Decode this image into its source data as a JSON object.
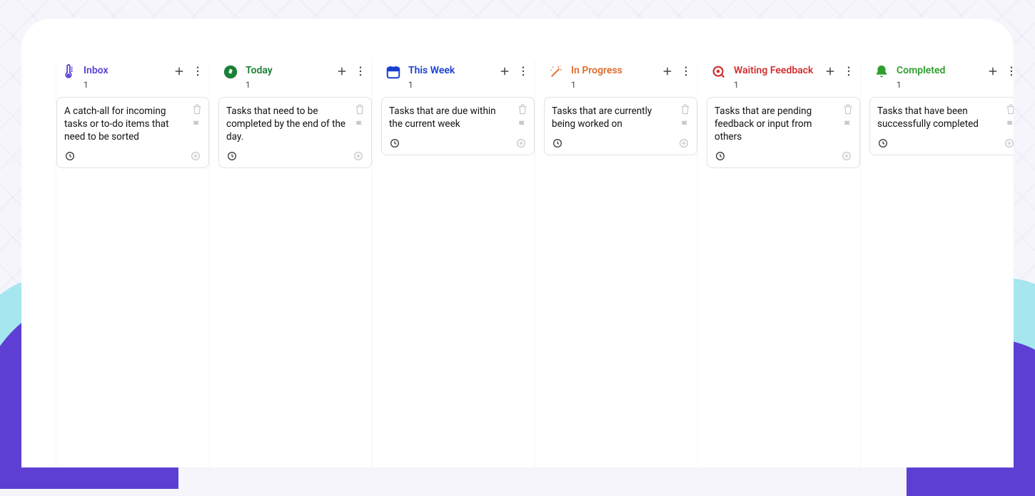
{
  "columns": [
    {
      "title": "Inbox",
      "count": "1",
      "icon": "thermometer-icon",
      "accent": "#5d3fd3",
      "card": {
        "text": "A catch-all for incoming tasks or to-do items that need to be sorted"
      }
    },
    {
      "title": "Today",
      "count": "1",
      "icon": "compass-icon",
      "accent": "#1a7f37",
      "card": {
        "text": "Tasks that need to be completed by the end of the day."
      }
    },
    {
      "title": "This Week",
      "count": "1",
      "icon": "calendar-icon",
      "accent": "#1a3fd3",
      "card": {
        "text": "Tasks that are due within the current week"
      }
    },
    {
      "title": "In Progress",
      "count": "1",
      "icon": "wand-icon",
      "accent": "#e06a2b",
      "card": {
        "text": "Tasks that are currently being worked on"
      }
    },
    {
      "title": "Waiting Feedback",
      "count": "1",
      "icon": "search-target-icon",
      "accent": "#d32f2f",
      "card": {
        "text": "Tasks that are pending feedback or input from others"
      }
    },
    {
      "title": "Completed",
      "count": "1",
      "icon": "bell-icon",
      "accent": "#2e9e2e",
      "card": {
        "text": "Tasks that have been successfully completed"
      }
    }
  ]
}
